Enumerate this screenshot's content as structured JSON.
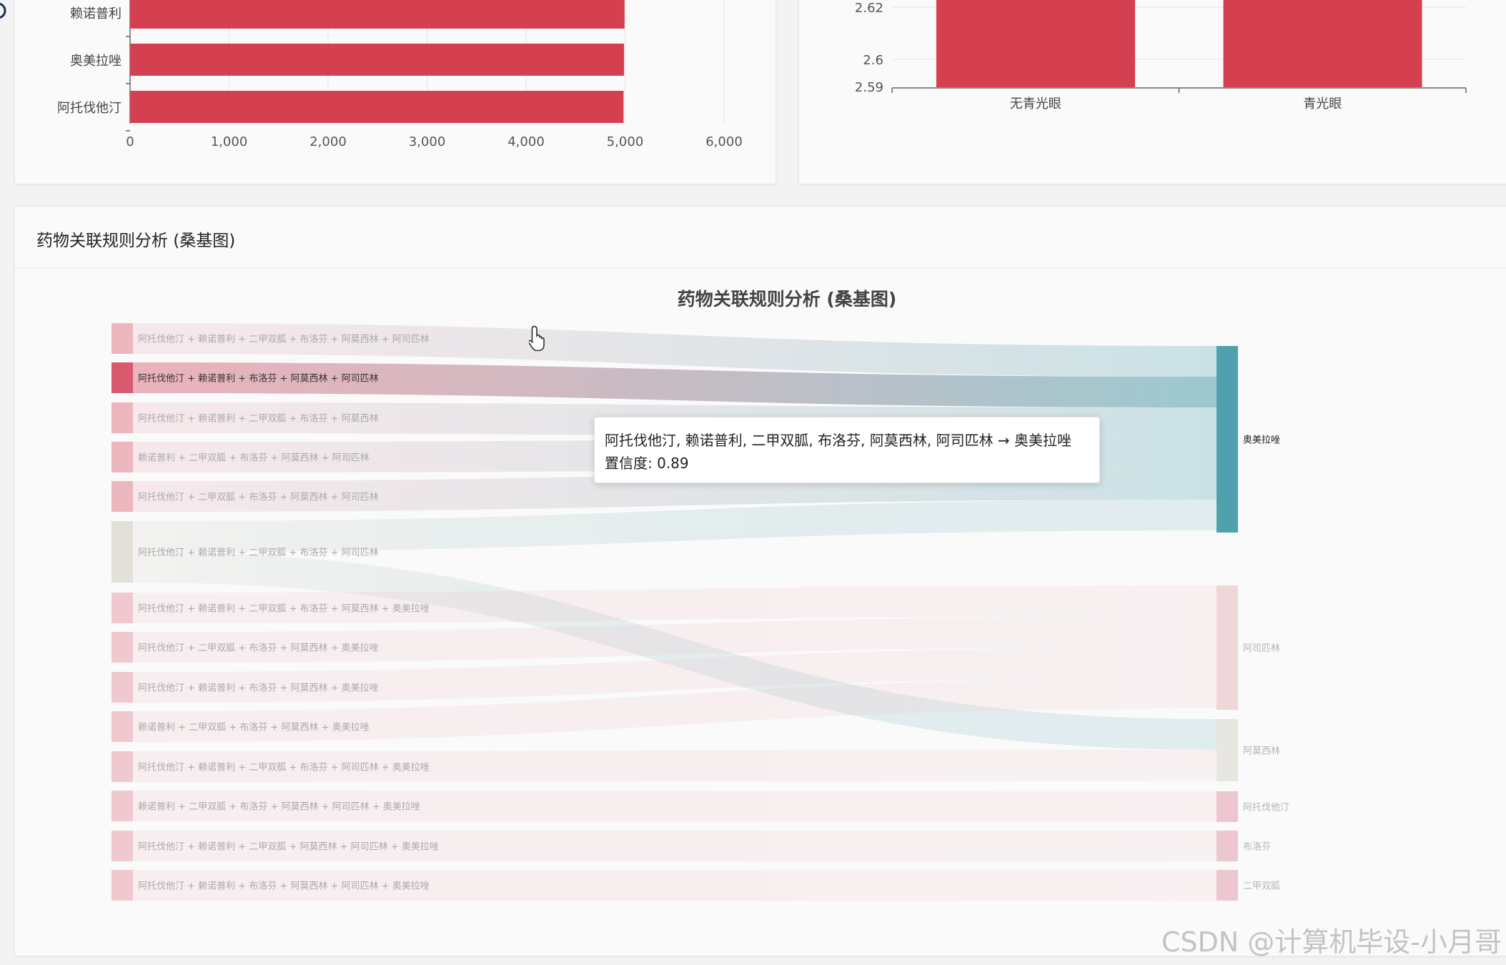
{
  "charts": {
    "top_left": {
      "categories": [
        "赖诺普利",
        "奥美拉唑",
        "阿托伐他汀"
      ],
      "values": [
        4995,
        4990,
        4985
      ],
      "x_ticks": [
        "0",
        "1,000",
        "2,000",
        "3,000",
        "4,000",
        "5,000",
        "6,000"
      ],
      "color": "#d44050"
    },
    "top_right": {
      "categories": [
        "无青光眼",
        "青光眼"
      ],
      "y_ticks": [
        "2.62",
        "2.6",
        "2.59"
      ],
      "color": "#d44050"
    }
  },
  "sankey_section": {
    "header_title": "药物关联规则分析 (桑基图)"
  },
  "chart_data": {
    "type": "sankey",
    "title": "药物关联规则分析 (桑基图)",
    "sources": [
      "阿托伐他汀 + 赖诺普利 + 二甲双胍 + 布洛芬 + 阿莫西林 + 阿司匹林",
      "阿托伐他汀 + 赖诺普利 + 布洛芬 + 阿莫西林 + 阿司匹林",
      "阿托伐他汀 + 赖诺普利 + 二甲双胍 + 布洛芬 + 阿莫西林",
      "赖诺普利 + 二甲双胍 + 布洛芬 + 阿莫西林 + 阿司匹林",
      "阿托伐他汀 + 二甲双胍 + 布洛芬 + 阿莫西林 + 阿司匹林",
      "阿托伐他汀 + 赖诺普利 + 二甲双胍 + 布洛芬 + 阿司匹林",
      "阿托伐他汀 + 赖诺普利 + 二甲双胍 + 布洛芬 + 阿莫西林 + 奥美拉唑",
      "阿托伐他汀 + 二甲双胍 + 布洛芬 + 阿莫西林 + 奥美拉唑",
      "阿托伐他汀 + 赖诺普利 + 布洛芬 + 阿莫西林 + 奥美拉唑",
      "赖诺普利 + 二甲双胍 + 布洛芬 + 阿莫西林 + 奥美拉唑",
      "阿托伐他汀 + 赖诺普利 + 二甲双胍 + 布洛芬 + 阿司匹林 + 奥美拉唑",
      "赖诺普利 + 二甲双胍 + 布洛芬 + 阿莫西林 + 阿司匹林 + 奥美拉唑",
      "阿托伐他汀 + 赖诺普利 + 二甲双胍 + 阿莫西林 + 阿司匹林 + 奥美拉唑",
      "阿托伐他汀 + 赖诺普利 + 布洛芬 + 阿莫西林 + 阿司匹林 + 奥美拉唑"
    ],
    "targets": [
      "奥美拉唑",
      "阿司匹林",
      "阿莫西林",
      "阿托伐他汀",
      "布洛芬",
      "二甲双胍"
    ],
    "links": [
      {
        "source": 0,
        "target": 0,
        "value": 1
      },
      {
        "source": 1,
        "target": 0,
        "value": 1
      },
      {
        "source": 2,
        "target": 0,
        "value": 1
      },
      {
        "source": 3,
        "target": 0,
        "value": 1
      },
      {
        "source": 4,
        "target": 0,
        "value": 1
      },
      {
        "source": 5,
        "target": 0,
        "value": 1
      },
      {
        "source": 5,
        "target": 2,
        "value": 1
      },
      {
        "source": 6,
        "target": 1,
        "value": 1
      },
      {
        "source": 7,
        "target": 1,
        "value": 1
      },
      {
        "source": 8,
        "target": 1,
        "value": 1
      },
      {
        "source": 9,
        "target": 1,
        "value": 1
      },
      {
        "source": 10,
        "target": 2,
        "value": 1
      },
      {
        "source": 11,
        "target": 3,
        "value": 1
      },
      {
        "source": 12,
        "target": 4,
        "value": 1
      },
      {
        "source": 13,
        "target": 5,
        "value": 1
      }
    ],
    "highlighted_source": 1,
    "colors": {
      "source_node": "#e9a9b4",
      "source_node_highlight": "#d85a6e",
      "source_node_alt": "#e2e0d8",
      "target_main": "#4ea1ad",
      "target_other": "#efd6d9",
      "target_alt": "#e8e6e0",
      "target_small": "#edc7cf"
    }
  },
  "tooltip": {
    "line1": "阿托伐他汀, 赖诺普利, 二甲双胍, 布洛芬, 阿莫西林, 阿司匹林 → 奥美拉唑",
    "line2": "置信度: 0.89"
  },
  "watermark": "CSDN @计算机毕设-小月哥"
}
